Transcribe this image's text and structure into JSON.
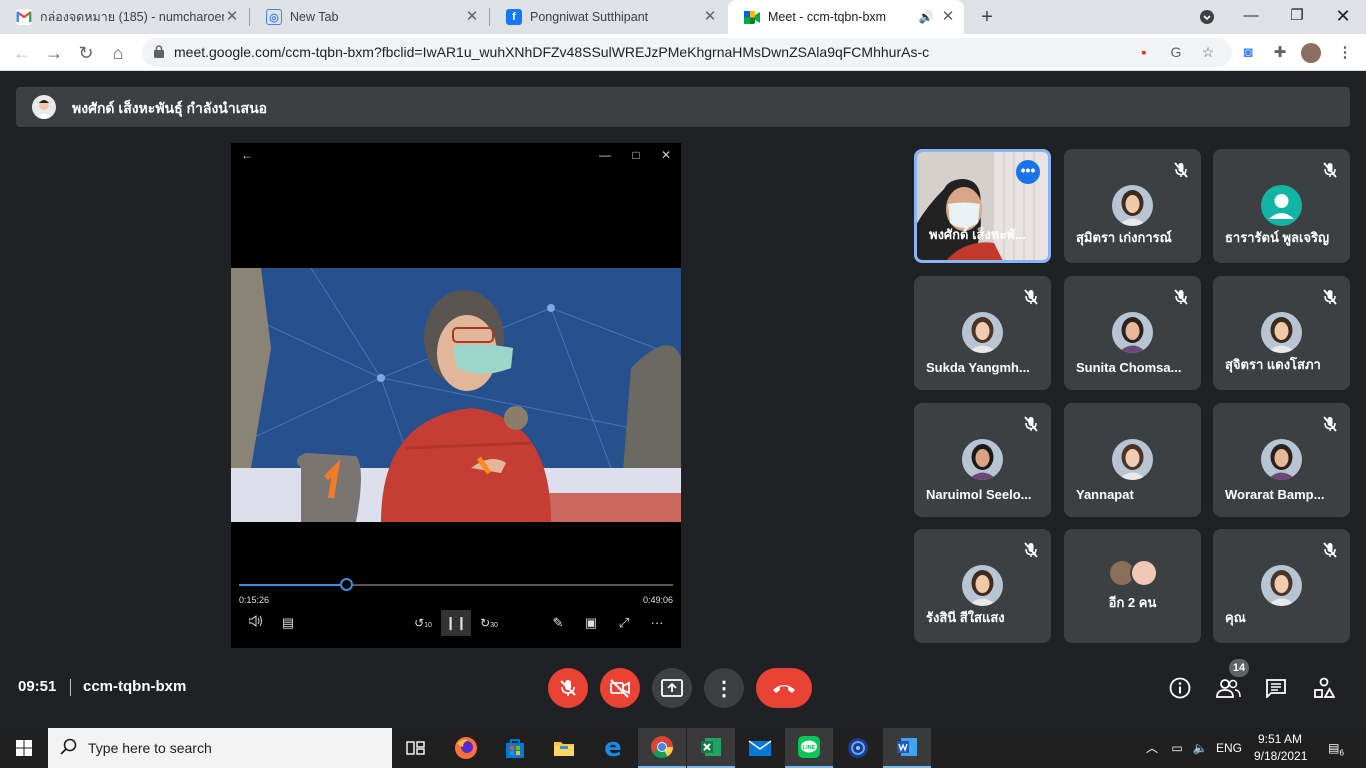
{
  "browser": {
    "tabs": [
      {
        "title": "กล่องจดหมาย (185) - numcharoen0",
        "icon": "gmail-icon"
      },
      {
        "title": "New Tab",
        "icon": "new-tab-icon"
      },
      {
        "title": "Pongniwat Sutthipant",
        "icon": "facebook-icon"
      },
      {
        "title": "Meet - ccm-tqbn-bxm",
        "icon": "meet-icon",
        "active": true
      }
    ],
    "url": "meet.google.com/ccm-tqbn-bxm?fbclid=IwAR1u_wuhXNhDFZv48SSulWREJzPMeKhgrnaHMsDwnZSAla9qFCMhhurAs-c"
  },
  "meet": {
    "presenter_banner": "พงศักด์ เส็งหะพันธุ์ กำลังนำเสนอ",
    "player": {
      "elapsed": "0:15:26",
      "duration": "0:49:06",
      "progress": 0.246,
      "skip_back_label": "10",
      "skip_forward_label": "30"
    },
    "participants": [
      {
        "name": "พงศักด์ เส็งหะพั...",
        "avatar": "video",
        "muted": false,
        "speaking": true
      },
      {
        "name": "สุมิตรา เก่งการณ์",
        "avatar": "photo",
        "muted": true
      },
      {
        "name": "ธารารัตน์ พูลเจริญ",
        "avatar": "default",
        "muted": true
      },
      {
        "name": "Sukda Yangmh...",
        "avatar": "photo",
        "muted": true
      },
      {
        "name": "Sunita Chomsa...",
        "avatar": "photo",
        "muted": true
      },
      {
        "name": "สุจิตรา แดงโสภา",
        "avatar": "photo",
        "muted": true
      },
      {
        "name": "Naruimol Seelo...",
        "avatar": "photo",
        "muted": true
      },
      {
        "name": "Yannapat",
        "avatar": "photo",
        "muted": false
      },
      {
        "name": "Worarat Bamp...",
        "avatar": "photo",
        "muted": true
      },
      {
        "name": "รังสินี สีใสแสง",
        "avatar": "photo",
        "muted": true
      },
      {
        "name": "อีก 2 คน",
        "avatar": "group",
        "muted": false
      },
      {
        "name": "คุณ",
        "avatar": "photo",
        "muted": true
      }
    ],
    "meeting_time": "09:51",
    "meeting_code": "ccm-tqbn-bxm",
    "participant_count": "14",
    "colors": {
      "accent": "#1a73e8",
      "danger": "#ea4335",
      "tile": "#3c4043",
      "background": "#202124"
    }
  },
  "taskbar": {
    "search_placeholder": "Type here to search",
    "apps": [
      "task-view-icon",
      "firefox-icon",
      "store-icon",
      "file-explorer-icon",
      "edge-icon",
      "chrome-icon",
      "excel-icon",
      "mail-icon",
      "line-icon",
      "app-icon",
      "word-icon"
    ],
    "language": "ENG",
    "time": "9:51 AM",
    "date": "9/18/2021",
    "notification_count": "6"
  }
}
